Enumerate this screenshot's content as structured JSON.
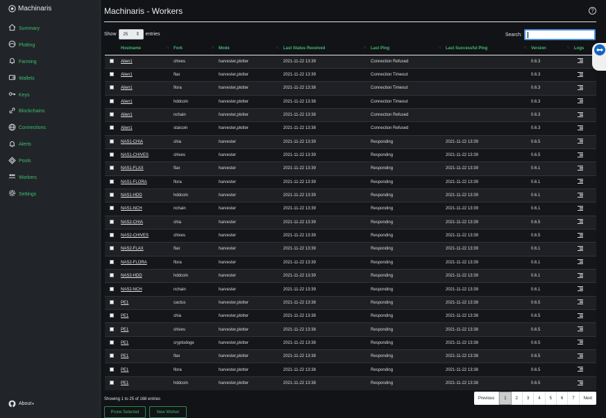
{
  "app": {
    "brand": "Machinaris"
  },
  "sidebar": {
    "items": [
      {
        "label": "Summary",
        "icon": "house-icon"
      },
      {
        "label": "Plotting",
        "icon": "plotting-icon"
      },
      {
        "label": "Farming",
        "icon": "bell-icon"
      },
      {
        "label": "Wallets",
        "icon": "wallet-icon"
      },
      {
        "label": "Keys",
        "icon": "key-icon"
      },
      {
        "label": "Blockchains",
        "icon": "link-icon"
      },
      {
        "label": "Connections",
        "icon": "globe-icon"
      },
      {
        "label": "Alerts",
        "icon": "bell-icon"
      },
      {
        "label": "Pools",
        "icon": "pools-icon"
      },
      {
        "label": "Workers",
        "icon": "workers-icon"
      },
      {
        "label": "Settings",
        "icon": "gear-icon"
      }
    ],
    "about": "About"
  },
  "header": {
    "title": "Machinaris - Workers"
  },
  "controls": {
    "show_label": "Show",
    "page_length": "25",
    "entries_label": "entries",
    "search_label": "Search:",
    "search_value": ""
  },
  "table": {
    "columns": [
      "Hostname",
      "Fork",
      "Mode",
      "Last Status Received",
      "Last Ping",
      "Last Successful Ping",
      "Version",
      "Logs"
    ],
    "rows": [
      {
        "host": "Alien1",
        "fork": "chives",
        "mode": "harvester,plotter",
        "status": "2021-11-22 13:39",
        "ping": "Connection Refused",
        "success": "",
        "version": "0.6.3"
      },
      {
        "host": "Alien1",
        "fork": "flax",
        "mode": "harvester,plotter",
        "status": "2021-11-22 13:39",
        "ping": "Connection Timeout",
        "success": "",
        "version": "0.6.3"
      },
      {
        "host": "Alien1",
        "fork": "flora",
        "mode": "harvester,plotter",
        "status": "2021-11-22 13:38",
        "ping": "Connection Timeout",
        "success": "",
        "version": "0.6.3"
      },
      {
        "host": "Alien1",
        "fork": "hddcoin",
        "mode": "harvester,plotter",
        "status": "2021-11-22 13:38",
        "ping": "Connection Timeout",
        "success": "",
        "version": "0.6.3"
      },
      {
        "host": "Alien1",
        "fork": "nchain",
        "mode": "harvester,plotter",
        "status": "2021-11-22 13:38",
        "ping": "Connection Refused",
        "success": "",
        "version": "0.6.3"
      },
      {
        "host": "Alien1",
        "fork": "staicoin",
        "mode": "harvester,plotter",
        "status": "2021-11-22 13:38",
        "ping": "Connection Refused",
        "success": "",
        "version": "0.6.3"
      },
      {
        "host": "NAS1-CHIA",
        "fork": "chia",
        "mode": "harvester",
        "status": "2021-11-22 13:39",
        "ping": "Responding",
        "success": "2021-11-22 13:39",
        "version": "0.6.5"
      },
      {
        "host": "NAS1-CHIVES",
        "fork": "chives",
        "mode": "harvester",
        "status": "2021-11-22 13:39",
        "ping": "Responding",
        "success": "2021-11-22 13:39",
        "version": "0.6.5"
      },
      {
        "host": "NAS1-FLAX",
        "fork": "flax",
        "mode": "harvester",
        "status": "2021-11-22 13:39",
        "ping": "Responding",
        "success": "2021-11-22 13:39",
        "version": "0.6.1"
      },
      {
        "host": "NAS1-FLORA",
        "fork": "flora",
        "mode": "harvester",
        "status": "2021-11-22 13:39",
        "ping": "Responding",
        "success": "2021-11-22 13:39",
        "version": "0.6.1"
      },
      {
        "host": "NAS1-HDD",
        "fork": "hddcoin",
        "mode": "harvester",
        "status": "2021-11-22 13:39",
        "ping": "Responding",
        "success": "2021-11-22 13:39",
        "version": "0.6.1"
      },
      {
        "host": "NAS1-NCH",
        "fork": "nchain",
        "mode": "harvester",
        "status": "2021-11-22 13:39",
        "ping": "Responding",
        "success": "2021-11-22 13:39",
        "version": "0.6.1"
      },
      {
        "host": "NAS2-CHIA",
        "fork": "chia",
        "mode": "harvester",
        "status": "2021-11-22 13:39",
        "ping": "Responding",
        "success": "2021-11-22 13:39",
        "version": "0.6.5"
      },
      {
        "host": "NAS2-CHIVES",
        "fork": "chives",
        "mode": "harvester",
        "status": "2021-11-22 13:39",
        "ping": "Responding",
        "success": "2021-11-22 13:39",
        "version": "0.6.5"
      },
      {
        "host": "NAS2-FLAX",
        "fork": "flax",
        "mode": "harvester",
        "status": "2021-11-22 13:39",
        "ping": "Responding",
        "success": "2021-11-22 13:39",
        "version": "0.6.1"
      },
      {
        "host": "NAS2-FLORA",
        "fork": "flora",
        "mode": "harvester",
        "status": "2021-11-22 13:39",
        "ping": "Responding",
        "success": "2021-11-22 13:39",
        "version": "0.6.1"
      },
      {
        "host": "NAS2-HDD",
        "fork": "hddcoin",
        "mode": "harvester",
        "status": "2021-11-22 13:39",
        "ping": "Responding",
        "success": "2021-11-22 13:39",
        "version": "0.6.1"
      },
      {
        "host": "NAS2-NCH",
        "fork": "nchain",
        "mode": "harvester",
        "status": "2021-11-22 13:39",
        "ping": "Responding",
        "success": "2021-11-22 13:39",
        "version": "0.6.1"
      },
      {
        "host": "PE1",
        "fork": "cactus",
        "mode": "harvester,plotter",
        "status": "2021-11-22 13:38",
        "ping": "Responding",
        "success": "2021-11-22 13:38",
        "version": "0.6.5"
      },
      {
        "host": "PE1",
        "fork": "chia",
        "mode": "harvester,plotter",
        "status": "2021-11-22 13:38",
        "ping": "Responding",
        "success": "2021-11-22 13:38",
        "version": "0.6.5"
      },
      {
        "host": "PE1",
        "fork": "chives",
        "mode": "harvester,plotter",
        "status": "2021-11-22 13:38",
        "ping": "Responding",
        "success": "2021-11-22 13:38",
        "version": "0.6.5"
      },
      {
        "host": "PE1",
        "fork": "cryptodoge",
        "mode": "harvester,plotter",
        "status": "2021-11-22 13:38",
        "ping": "Responding",
        "success": "2021-11-22 13:38",
        "version": "0.6.5"
      },
      {
        "host": "PE1",
        "fork": "flax",
        "mode": "harvester,plotter",
        "status": "2021-11-22 13:38",
        "ping": "Responding",
        "success": "2021-11-22 13:38",
        "version": "0.6.5"
      },
      {
        "host": "PE1",
        "fork": "flora",
        "mode": "harvester,plotter",
        "status": "2021-11-22 13:38",
        "ping": "Responding",
        "success": "2021-11-22 13:38",
        "version": "0.6.5"
      },
      {
        "host": "PE1",
        "fork": "hddcoin",
        "mode": "harvester,plotter",
        "status": "2021-11-22 13:38",
        "ping": "Responding",
        "success": "2021-11-22 13:38",
        "version": "0.6.5"
      }
    ]
  },
  "footer": {
    "info": "Showing 1 to 25 of 168 entries",
    "pager": [
      "Previous",
      "1",
      "2",
      "3",
      "4",
      "5",
      "6",
      "7",
      "Next"
    ],
    "active_page": "1",
    "prune_label": "Prune Selected",
    "new_worker_label": "New Worker"
  },
  "colors": {
    "accent": "#3fbf6a",
    "sidebar_bg": "#212529",
    "main_bg": "#111317"
  }
}
